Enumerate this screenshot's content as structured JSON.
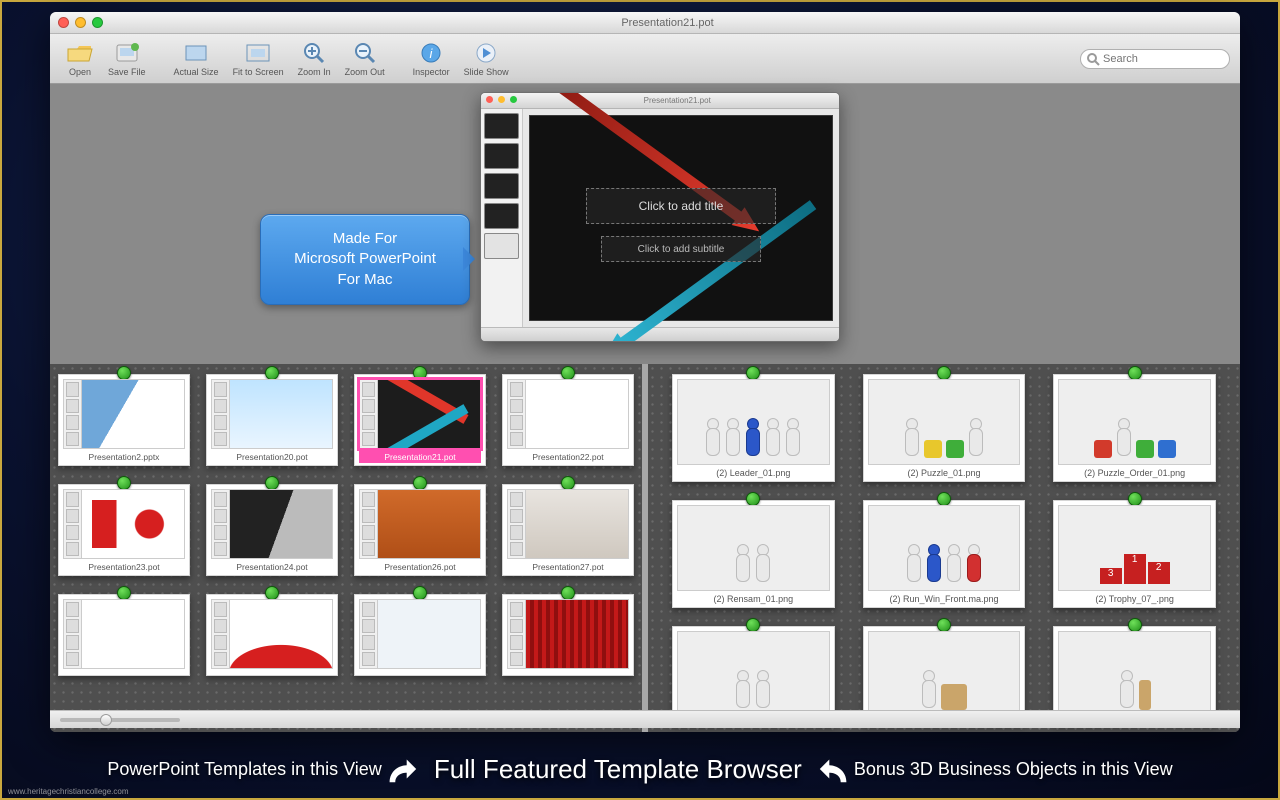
{
  "window": {
    "title": "Presentation21.pot"
  },
  "toolbar": {
    "open": "Open",
    "save": "Save File",
    "actual": "Actual Size",
    "fit": "Fit to Screen",
    "zin": "Zoom In",
    "zout": "Zoom Out",
    "inspector": "Inspector",
    "slideshow": "Slide Show",
    "search_placeholder": "Search"
  },
  "callout": {
    "line1": "Made For",
    "line2": "Microsoft PowerPoint",
    "line3": "For Mac"
  },
  "slide": {
    "title_ph": "Click to add title",
    "sub_ph": "Click to add subtitle"
  },
  "templates": [
    {
      "label": "Presentation2.pptx",
      "art": "art-blue"
    },
    {
      "label": "Presentation20.pot",
      "art": "art-sky"
    },
    {
      "label": "Presentation21.pot",
      "art": "art-dark",
      "selected": true
    },
    {
      "label": "Presentation22.pot",
      "art": "art-ic"
    },
    {
      "label": "Presentation23.pot",
      "art": "art-red"
    },
    {
      "label": "Presentation24.pot",
      "art": "art-bw"
    },
    {
      "label": "Presentation26.pot",
      "art": "art-or"
    },
    {
      "label": "Presentation27.pot",
      "art": "art-ph"
    },
    {
      "label": "",
      "art": "art-dots"
    },
    {
      "label": "",
      "art": "art-wave"
    },
    {
      "label": "",
      "art": "art-sq"
    },
    {
      "label": "",
      "art": "art-stripe"
    }
  ],
  "objects": [
    {
      "label": "(2) Leader_01.png",
      "kind": "leader"
    },
    {
      "label": "(2) Puzzle_01.png",
      "kind": "puzzle"
    },
    {
      "label": "(2) Puzzle_Order_01.png",
      "kind": "puzzle2"
    },
    {
      "label": "(2) Rensam_01.png",
      "kind": "carry"
    },
    {
      "label": "(2) Run_Win_Front.ma.png",
      "kind": "race"
    },
    {
      "label": "(2) Trophy_07_.png",
      "kind": "podium"
    },
    {
      "label": "",
      "kind": "pair"
    },
    {
      "label": "",
      "kind": "box"
    },
    {
      "label": "",
      "kind": "stack"
    }
  ],
  "banner": {
    "left": "PowerPoint Templates in this View",
    "mid": "Full Featured Template Browser",
    "right": "Bonus 3D Business Objects in this View"
  },
  "watermark": "www.heritagechristiancollege.com"
}
